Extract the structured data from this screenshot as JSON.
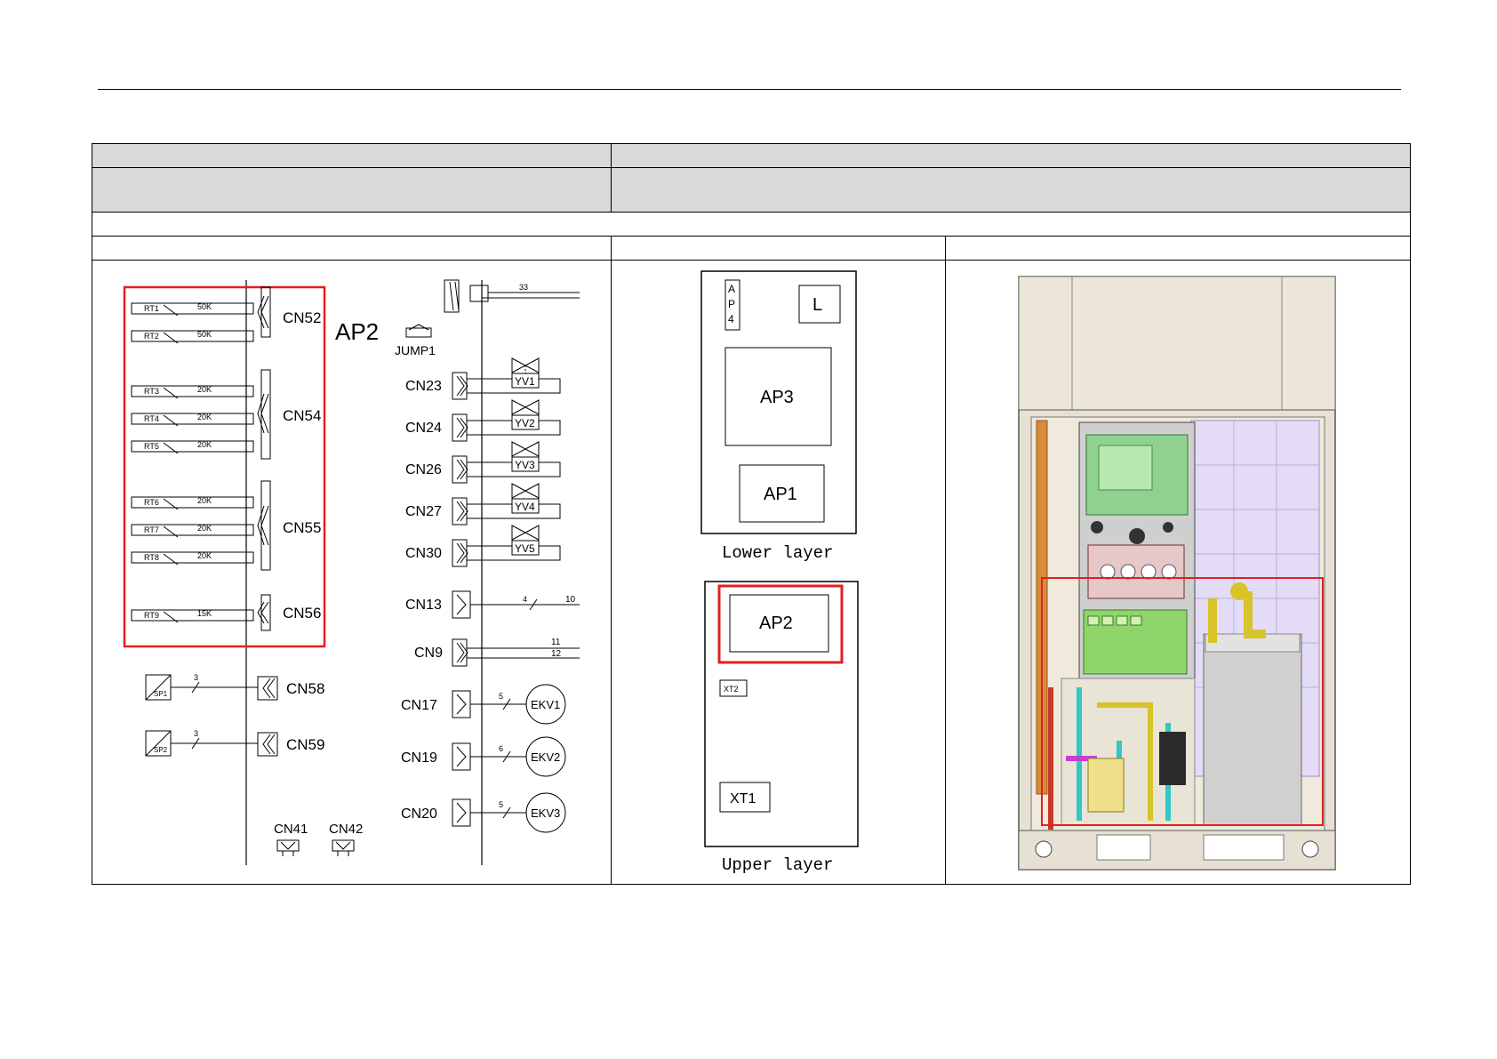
{
  "board": {
    "title": "AP2",
    "jumper": "JUMP1",
    "sensor_connectors": [
      {
        "name": "CN52",
        "sensors": [
          {
            "id": "RT1",
            "value": "50K"
          },
          {
            "id": "RT2",
            "value": "50K"
          }
        ]
      },
      {
        "name": "CN54",
        "sensors": [
          {
            "id": "RT3",
            "value": "20K"
          },
          {
            "id": "RT4",
            "value": "20K"
          },
          {
            "id": "RT5",
            "value": "20K"
          }
        ]
      },
      {
        "name": "CN55",
        "sensors": [
          {
            "id": "RT6",
            "value": "20K"
          },
          {
            "id": "RT7",
            "value": "20K"
          },
          {
            "id": "RT8",
            "value": "20K"
          }
        ]
      },
      {
        "name": "CN56",
        "sensors": [
          {
            "id": "RT9",
            "value": "15K"
          }
        ]
      }
    ],
    "pressure_sensors": [
      {
        "id": "SP1",
        "wires": "3",
        "connector": "CN58"
      },
      {
        "id": "SP2",
        "wires": "3",
        "connector": "CN59"
      }
    ],
    "bottom_connectors": [
      "CN41",
      "CN42"
    ],
    "top_wire": "33",
    "valves": [
      {
        "connector": "CN23",
        "valve": "YV1"
      },
      {
        "connector": "CN24",
        "valve": "YV2"
      },
      {
        "connector": "CN26",
        "valve": "YV3"
      },
      {
        "connector": "CN27",
        "valve": "YV4"
      },
      {
        "connector": "CN30",
        "valve": "YV5"
      }
    ],
    "comm": [
      {
        "connector": "CN13",
        "wires": "4",
        "label": "10"
      },
      {
        "connector": "CN9",
        "label_a": "11",
        "label_b": "12"
      }
    ],
    "expansion_valves": [
      {
        "connector": "CN17",
        "wires": "5",
        "name": "EKV1"
      },
      {
        "connector": "CN19",
        "wires": "6",
        "name": "EKV2"
      },
      {
        "connector": "CN20",
        "wires": "5",
        "name": "EKV3"
      }
    ]
  },
  "layout": {
    "lower": {
      "ap4": [
        "A",
        "P",
        "4"
      ],
      "l": "L",
      "ap3": "AP3",
      "ap1": "AP1",
      "caption": "Lower  layer"
    },
    "upper": {
      "ap2": "AP2",
      "xt2": "XT2",
      "xt1": "XT1",
      "caption": "Upper  layer"
    }
  },
  "colors": {
    "highlight": "#e02020",
    "header_fill": "#d9d9d9",
    "line": "#000000"
  }
}
